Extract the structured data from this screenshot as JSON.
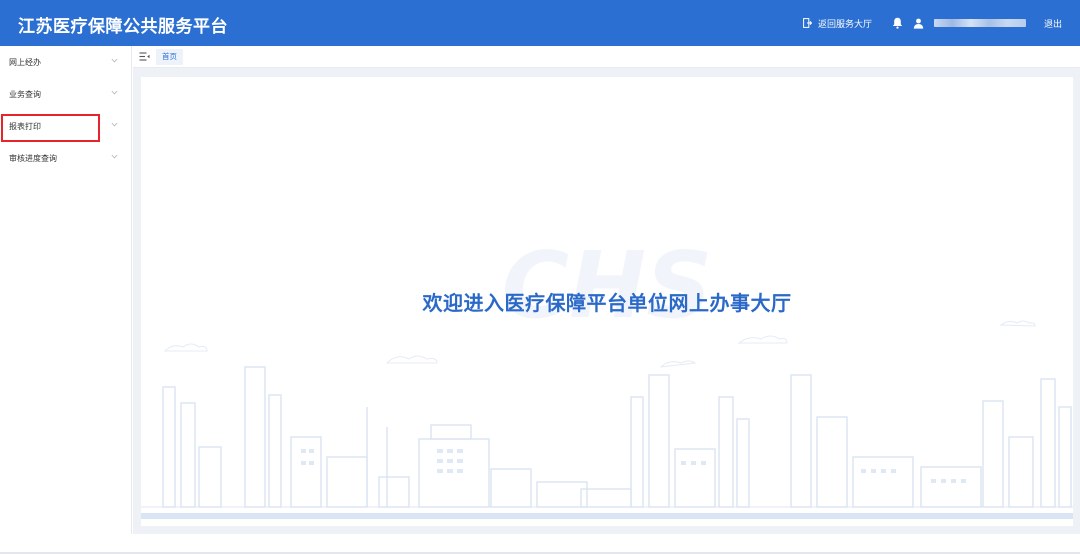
{
  "header": {
    "title": "江苏医疗保障公共服务平台",
    "back_label": "返回服务大厅",
    "logout_label": "退出",
    "brand_color": "#2a6fd1"
  },
  "sidebar": {
    "items": [
      {
        "label": "网上经办"
      },
      {
        "label": "业务查询"
      },
      {
        "label": "报表打印",
        "highlighted": true
      },
      {
        "label": "审核进度查询"
      }
    ]
  },
  "tabs": {
    "home_label": "首页"
  },
  "main": {
    "welcome_text": "欢迎进入医疗保障平台单位网上办事大厅",
    "watermark_text": "CHS"
  },
  "icons": {
    "back": "exit-door-icon",
    "bell": "bell-icon",
    "user": "user-icon",
    "menu": "menu-fold-icon",
    "chevron": "chevron-down-icon"
  }
}
